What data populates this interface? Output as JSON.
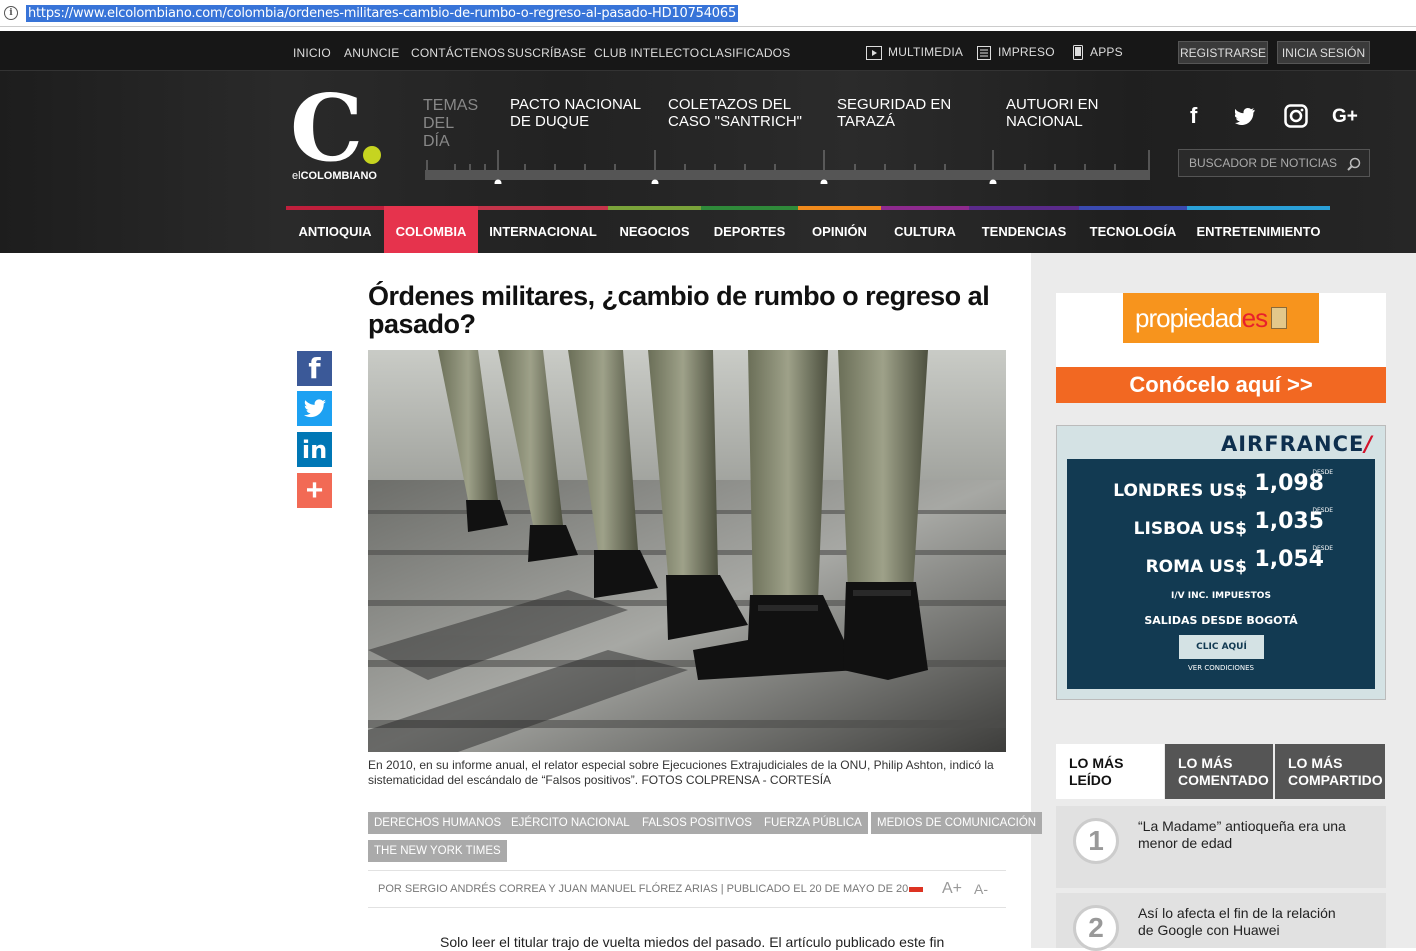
{
  "browser": {
    "url": "https://www.elcolombiano.com/colombia/ordenes-militares-cambio-de-rumbo-o-regreso-al-pasado-HD10754065"
  },
  "topnav": {
    "items": [
      "INICIO",
      "ANUNCIE",
      "CONTÁCTENOS",
      "SUSCRÍBASE",
      "CLUB INTELECTO",
      "CLASIFICADOS"
    ],
    "multimedia": "MULTIMEDIA",
    "impreso": "IMPRESO",
    "apps": "APPS",
    "register": "REGISTRARSE",
    "login": "INICIA SESIÓN"
  },
  "logo": {
    "letter": "C",
    "brand_prefix": "el",
    "brand": "COLOMBIANO"
  },
  "temas": {
    "label_1": "TEMAS",
    "label_2": "DEL",
    "label_3": "DÍA",
    "topics": [
      {
        "l1": "PACTO NACIONAL",
        "l2": "DE DUQUE"
      },
      {
        "l1": "COLETAZOS DEL",
        "l2": "CASO \"SANTRICH\""
      },
      {
        "l1": "SEGURIDAD EN",
        "l2": "TARAZÁ"
      },
      {
        "l1": "AUTUORI EN",
        "l2": "NACIONAL"
      }
    ]
  },
  "social": {
    "facebook": "f",
    "google": "G+"
  },
  "search": {
    "placeholder": "BUSCADOR DE NOTICIAS"
  },
  "categories": [
    {
      "label": "ANTIOQUIA",
      "color": "#c01f3c"
    },
    {
      "label": "COLOMBIA",
      "color": "#e6334d"
    },
    {
      "label": "INTERNACIONAL",
      "color": "#c4344a"
    },
    {
      "label": "NEGOCIOS",
      "color": "#7aa33a"
    },
    {
      "label": "DEPORTES",
      "color": "#2f8a3a"
    },
    {
      "label": "OPINIÓN",
      "color": "#f08a1c"
    },
    {
      "label": "CULTURA",
      "color": "#8e2a8e"
    },
    {
      "label": "TENDENCIAS",
      "color": "#5a2a8a"
    },
    {
      "label": "TECNOLOGÍA",
      "color": "#3a4ab0"
    },
    {
      "label": "ENTRETENIMIENTO",
      "color": "#2aa0d8"
    }
  ],
  "article": {
    "title": "Órdenes militares, ¿cambio de rumbo o regreso al pasado?",
    "caption": "En 2010, en su informe anual, el relator especial sobre Ejecuciones Extrajudiciales de la ONU, Philip Ashton, indicó la sistematicidad del escándalo de “Falsos positivos”. FOTOS COLPRENSA - CORTESÍA",
    "tags": [
      "DERECHOS HUMANOS",
      "EJÉRCITO NACIONAL",
      "FALSOS POSITIVOS",
      "FUERZA PÚBLICA",
      "MEDIOS DE COMUNICACIÓN",
      "THE NEW YORK TIMES"
    ],
    "byline": "POR SERGIO ANDRÉS CORREA Y JUAN MANUEL FLÓREZ ARIAS | PUBLICADO EL 20 DE MAYO DE 20",
    "font_up": "A+",
    "font_down": "A-",
    "body_start": "Solo leer el titular trajo de vuelta miedos del pasado. El artículo publicado este fin"
  },
  "share": {
    "facebook": "f",
    "twitter": "t",
    "linkedin": "in",
    "more": "+"
  },
  "ads": {
    "propiedades": {
      "word_1": "propiedad",
      "word_2": "es",
      "cta": "Conócelo aquí >>"
    },
    "airfrance": {
      "brand": "AIRFRANCE",
      "routes": [
        {
          "city": "LONDRES",
          "currency": "US$",
          "desde": "DESDE",
          "price": "1,098"
        },
        {
          "city": "LISBOA",
          "currency": "US$",
          "desde": "DESDE",
          "price": "1,035"
        },
        {
          "city": "ROMA",
          "currency": "US$",
          "desde": "DESDE",
          "price": "1,054"
        }
      ],
      "taxes": "I/V INC. IMPUESTOS",
      "salidas": "SALIDAS DESDE BOGOTÁ",
      "cta": "CLIC AQUÍ",
      "conditions": "VER CONDICIONES"
    }
  },
  "most": {
    "tabs": [
      {
        "l1": "LO MÁS",
        "l2": "LEÍDO"
      },
      {
        "l1": "LO MÁS",
        "l2": "COMENTADO"
      },
      {
        "l1": "LO MÁS",
        "l2": "COMPARTIDO"
      }
    ],
    "items": [
      {
        "rank": "1",
        "l1": "“La Madame” antioqueña era una",
        "l2": "menor de edad"
      },
      {
        "rank": "2",
        "l1": "Así lo afecta el fin de la relación",
        "l2": "de Google con Huawei"
      }
    ]
  }
}
